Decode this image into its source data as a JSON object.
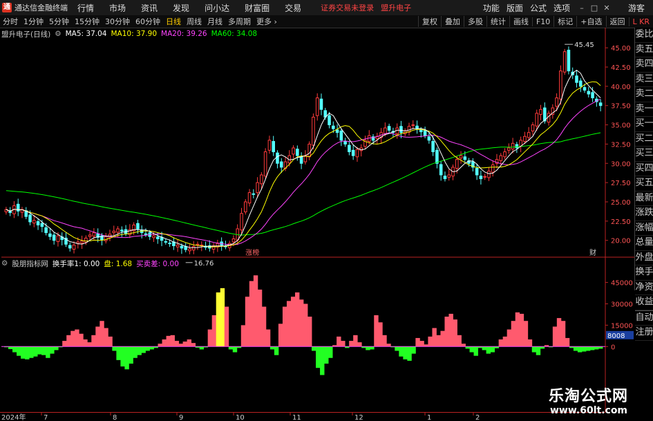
{
  "menubar": {
    "app_title": "通达信金融终端",
    "items": [
      "行情",
      "市场",
      "资讯",
      "发现",
      "问小达",
      "财富圈",
      "交易"
    ],
    "login_status": "证券交易未登录",
    "stock_name": "盟升电子",
    "right_items": [
      "功能",
      "版面",
      "公式",
      "选项"
    ],
    "guest": "游客"
  },
  "toolbar": {
    "periods": [
      "分时",
      "1分钟",
      "5分钟",
      "15分钟",
      "30分钟",
      "60分钟",
      "日线",
      "周线",
      "月线",
      "多周期",
      "更多"
    ],
    "active": "日线",
    "right_buttons": [
      "复权",
      "叠加",
      "多股",
      "统计",
      "画线",
      "F10",
      "标记",
      "+自选",
      "返回"
    ]
  },
  "ma_legend": {
    "title": "盟升电子(日线)",
    "items": [
      {
        "label": "MA5: 37.04",
        "color": "#ffffff"
      },
      {
        "label": "MA10: 37.90",
        "color": "#ffff00"
      },
      {
        "label": "MA20: 39.26",
        "color": "#ff44ff"
      },
      {
        "label": "MA60: 34.08",
        "color": "#00ff00"
      }
    ]
  },
  "indicator_legend": {
    "title": "股朋指标网",
    "items": [
      {
        "label": "换手率1: 0.00",
        "color": "#ffffff"
      },
      {
        "label": "盘: 1.68",
        "color": "#ffff00"
      },
      {
        "label": "买卖差: 0.00",
        "color": "#ff44ff"
      }
    ]
  },
  "right_panel": [
    "委比",
    "卖五",
    "卖四",
    "卖三",
    "卖二",
    "卖一",
    "买一",
    "买二",
    "买三",
    "买四",
    "买五",
    "最新",
    "涨跌",
    "涨幅",
    "总量",
    "外盘",
    "换手",
    "净资",
    "收益"
  ],
  "right_panel_bottom": [
    "自动",
    "注册"
  ],
  "price_axis": {
    "labels": [
      "45.00",
      "42.50",
      "40.00",
      "37.50",
      "35.00",
      "32.50",
      "30.00",
      "27.50",
      "25.00",
      "22.50",
      "20.00"
    ]
  },
  "indicator_axis": {
    "labels": [
      "45000",
      "30000",
      "15000",
      "0"
    ],
    "current": "8008"
  },
  "annotations": {
    "high": "45.45",
    "low": "16.76",
    "tag_middle": "涨榜",
    "tag_right": "财"
  },
  "dates": [
    "2024年",
    "7",
    "8",
    "9",
    "10",
    "11",
    "12",
    "1",
    "2"
  ],
  "watermark": {
    "title": "乐淘公式网",
    "url": "www.60lt.com"
  },
  "chart_data": [
    {
      "type": "candlestick",
      "title": "盟升电子(日线)",
      "ylim": [
        18,
        46
      ],
      "close": [
        24.0,
        23.6,
        24.5,
        23.8,
        24.0,
        23.1,
        22.4,
        22.6,
        22.0,
        21.8,
        21.0,
        20.5,
        20.0,
        20.6,
        20.1,
        19.5,
        19.0,
        19.4,
        19.8,
        19.9,
        20.3,
        20.7,
        21.0,
        20.4,
        20.1,
        20.5,
        20.8,
        21.2,
        21.5,
        21.2,
        20.9,
        21.4,
        22.0,
        21.5,
        21.0,
        20.8,
        20.5,
        20.6,
        20.2,
        20.0,
        19.8,
        19.6,
        19.3,
        19.4,
        19.0,
        18.8,
        18.9,
        19.2,
        19.5,
        19.4,
        19.1,
        19.0,
        19.3,
        19.6,
        19.4,
        19.2,
        19.6,
        20.2,
        21.5,
        23.5,
        25.0,
        26.2,
        26.0,
        27.5,
        28.5,
        31.5,
        33.0,
        31.5,
        30.0,
        29.5,
        30.2,
        31.0,
        32.0,
        31.0,
        30.0,
        31.0,
        32.5,
        36.0,
        38.5,
        37.0,
        36.0,
        35.0,
        34.5,
        34.0,
        33.0,
        32.5,
        31.5,
        31.0,
        31.8,
        32.0,
        33.0,
        33.6,
        33.0,
        33.5,
        34.0,
        34.6,
        34.3,
        34.0,
        34.6,
        34.0,
        34.2,
        34.8,
        35.0,
        34.5,
        34.1,
        33.6,
        33.0,
        31.5,
        30.0,
        28.5,
        28.0,
        28.5,
        29.5,
        30.5,
        31.0,
        30.5,
        30.0,
        29.5,
        28.5,
        28.0,
        28.3,
        29.0,
        29.8,
        30.5,
        31.0,
        31.5,
        32.0,
        32.6,
        32.0,
        33.0,
        33.5,
        34.0,
        35.0,
        36.5,
        37.0,
        35.5,
        36.5,
        37.2,
        38.5,
        42.0,
        44.5,
        42.0,
        41.5,
        40.5,
        40.0,
        39.5,
        39.0,
        38.5,
        38.0,
        37.5
      ],
      "high": 45.45,
      "low": 16.76,
      "ma60_end": 34.08
    },
    {
      "type": "bar",
      "title": "股朋指标网",
      "ylim": [
        -45000,
        55000
      ],
      "yticks": [
        45000,
        30000,
        15000,
        0
      ],
      "values": [
        -500,
        -1800,
        -4000,
        -6500,
        -8500,
        -9000,
        -8000,
        -7000,
        -5500,
        -6000,
        -8000,
        -5000,
        -2500,
        -500,
        4000,
        8000,
        11000,
        12000,
        9000,
        5000,
        3000,
        8000,
        14000,
        18000,
        13000,
        7000,
        -3000,
        -9500,
        -14000,
        -16000,
        -12000,
        -8000,
        -6000,
        -4500,
        -3000,
        -2000,
        -1000,
        2000,
        5000,
        7500,
        8000,
        4000,
        2000,
        3500,
        5000,
        2500,
        -800,
        -2000,
        -600,
        12000,
        22000,
        38000,
        41000,
        28000,
        -2000,
        -4000,
        -1000,
        15000,
        35000,
        46000,
        50000,
        40000,
        28000,
        12000,
        -2000,
        -6000,
        16000,
        28000,
        32000,
        35000,
        38000,
        33000,
        30000,
        21000,
        -3000,
        -15000,
        -20000,
        -12000,
        -8000,
        1000,
        7000,
        4000,
        -1000,
        4000,
        8000,
        3000,
        -1000,
        -2500,
        -2000,
        22000,
        17000,
        8000,
        2000,
        -500,
        -3000,
        -7000,
        -9000,
        -10000,
        -5000,
        6000,
        4000,
        1500,
        7000,
        13000,
        8000,
        11000,
        21000,
        23000,
        19000,
        8000,
        2000,
        -1500,
        -4000,
        -6500,
        -1000,
        -2500,
        -5000,
        -4000,
        -1200,
        5000,
        7000,
        12000,
        18000,
        24000,
        23000,
        18000,
        5000,
        -4000,
        -6000,
        -1500,
        1000,
        -500,
        14000,
        20000,
        18000,
        6000,
        -1000,
        -3000,
        -4000,
        -3500,
        -3000,
        -2500,
        -2000,
        -1500
      ]
    }
  ]
}
